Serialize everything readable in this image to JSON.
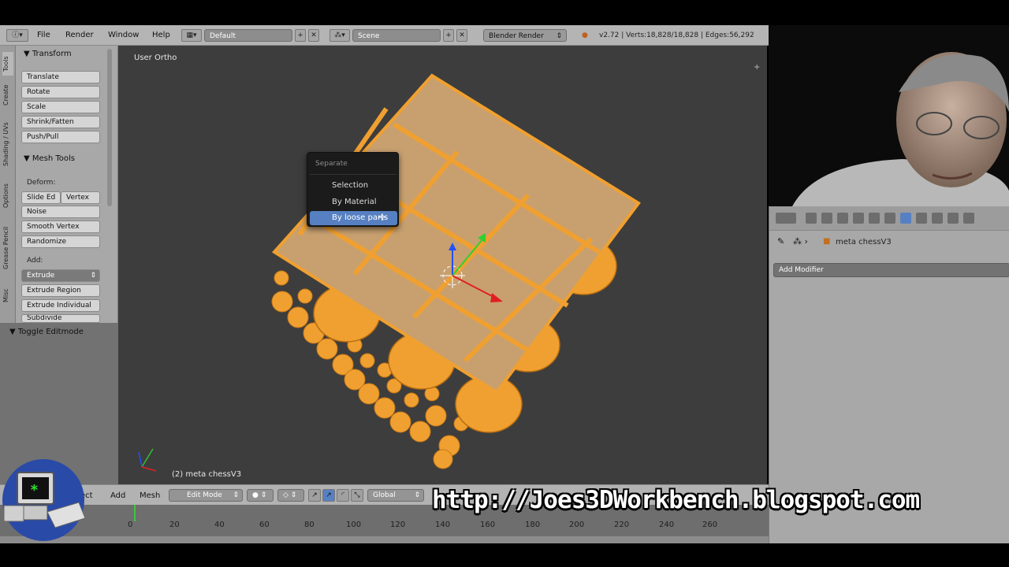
{
  "topbar": {
    "menus": [
      "File",
      "Render",
      "Window",
      "Help"
    ],
    "layout": "Default",
    "scene": "Scene",
    "engine": "Blender Render",
    "status": "v2.72 | Verts:18,828/18,828 | Edges:56,292"
  },
  "tool_tabs": [
    "Tools",
    "Create",
    "Shading / UVs",
    "Options",
    "Grease Pencil",
    "Misc"
  ],
  "tool_shelf": {
    "transform_header": "Transform",
    "transform_buttons": [
      "Translate",
      "Rotate",
      "Scale",
      "Shrink/Fatten",
      "Push/Pull"
    ],
    "mesh_tools_header": "Mesh Tools",
    "deform_label": "Deform:",
    "slide_edge": "Slide Ed",
    "vertex": "Vertex",
    "noise": "Noise",
    "smooth_vertex": "Smooth Vertex",
    "randomize": "Randomize",
    "add_label": "Add:",
    "extrude": "Extrude",
    "extrude_region": "Extrude Region",
    "extrude_individual": "Extrude Individual",
    "subdivide": "Subdivide",
    "toggle_editmode": "Toggle Editmode"
  },
  "viewport": {
    "view_name": "User Ortho",
    "object_info": "(2) meta chessV3"
  },
  "separate_menu": {
    "title": "Separate",
    "items": [
      "Selection",
      "By Material",
      "By loose parts"
    ],
    "selected_index": 2
  },
  "bottombar": {
    "menus": [
      "ect",
      "Add",
      "Mesh"
    ],
    "mode": "Edit Mode",
    "orientation": "Global"
  },
  "timeline": {
    "ticks": [
      "0",
      "20",
      "40",
      "60",
      "80",
      "100",
      "120",
      "140",
      "160",
      "180",
      "200",
      "220",
      "240",
      "260"
    ],
    "current_frame": 1
  },
  "properties": {
    "object_name": "meta chessV3",
    "add_modifier": "Add Modifier"
  },
  "overlay": {
    "url": "http://Joes3DWorkbench.blogspot.com"
  },
  "colors": {
    "mesh_selected": "#f0a030",
    "viewport_bg": "#3d3d3d",
    "menu_highlight": "#5680c2"
  }
}
